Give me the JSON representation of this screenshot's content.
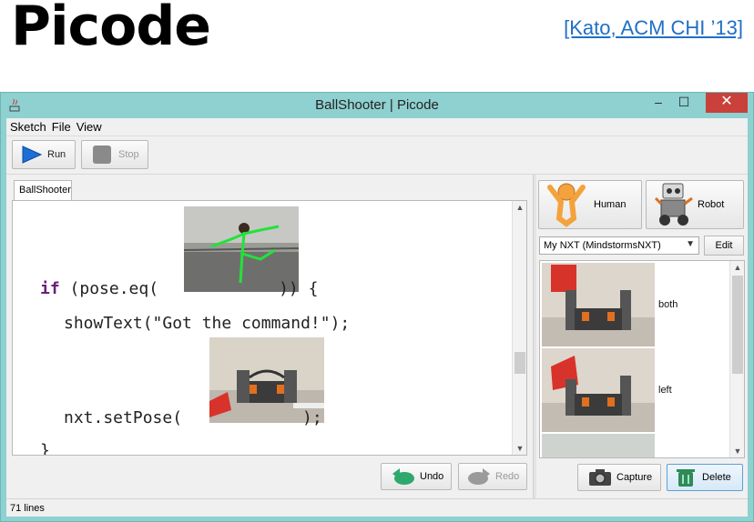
{
  "slide": {
    "title": "Picode",
    "citation": "[Kato, ACM CHI ’13]"
  },
  "window": {
    "title": "BallShooter | Picode",
    "minimize": "–",
    "maximize": "☐",
    "close": "✕"
  },
  "menu": [
    "Sketch",
    "File",
    "View"
  ],
  "toolbar": {
    "run_label": "Run",
    "stop_label": "Stop"
  },
  "editor": {
    "tab_label": "BallShooter",
    "lines": {
      "if_kw": "if",
      "if_pre": " (pose.eq(",
      "if_post": ")) {",
      "show_text": "showText(\"Got the command!\");",
      "set_pose_pre": "nxt.setPose(",
      "set_pose_post": ");",
      "brace": "}"
    },
    "undo_label": "Undo",
    "redo_label": "Redo"
  },
  "side": {
    "human_label": "Human",
    "robot_label": "Robot",
    "device_select": "My NXT (MindstormsNXT)",
    "edit_label": "Edit",
    "poses": [
      {
        "label": "both"
      },
      {
        "label": "left"
      }
    ],
    "capture_label": "Capture",
    "delete_label": "Delete"
  },
  "status": {
    "lines_text": "71 lines"
  },
  "colors": {
    "window_frame": "#8fd0d0",
    "close_button": "#c9413a",
    "keyword": "#6b1f7a",
    "citation_link": "#1f6fc5",
    "run_icon": "#1c6fd6",
    "undo_icon": "#2ea86b"
  }
}
